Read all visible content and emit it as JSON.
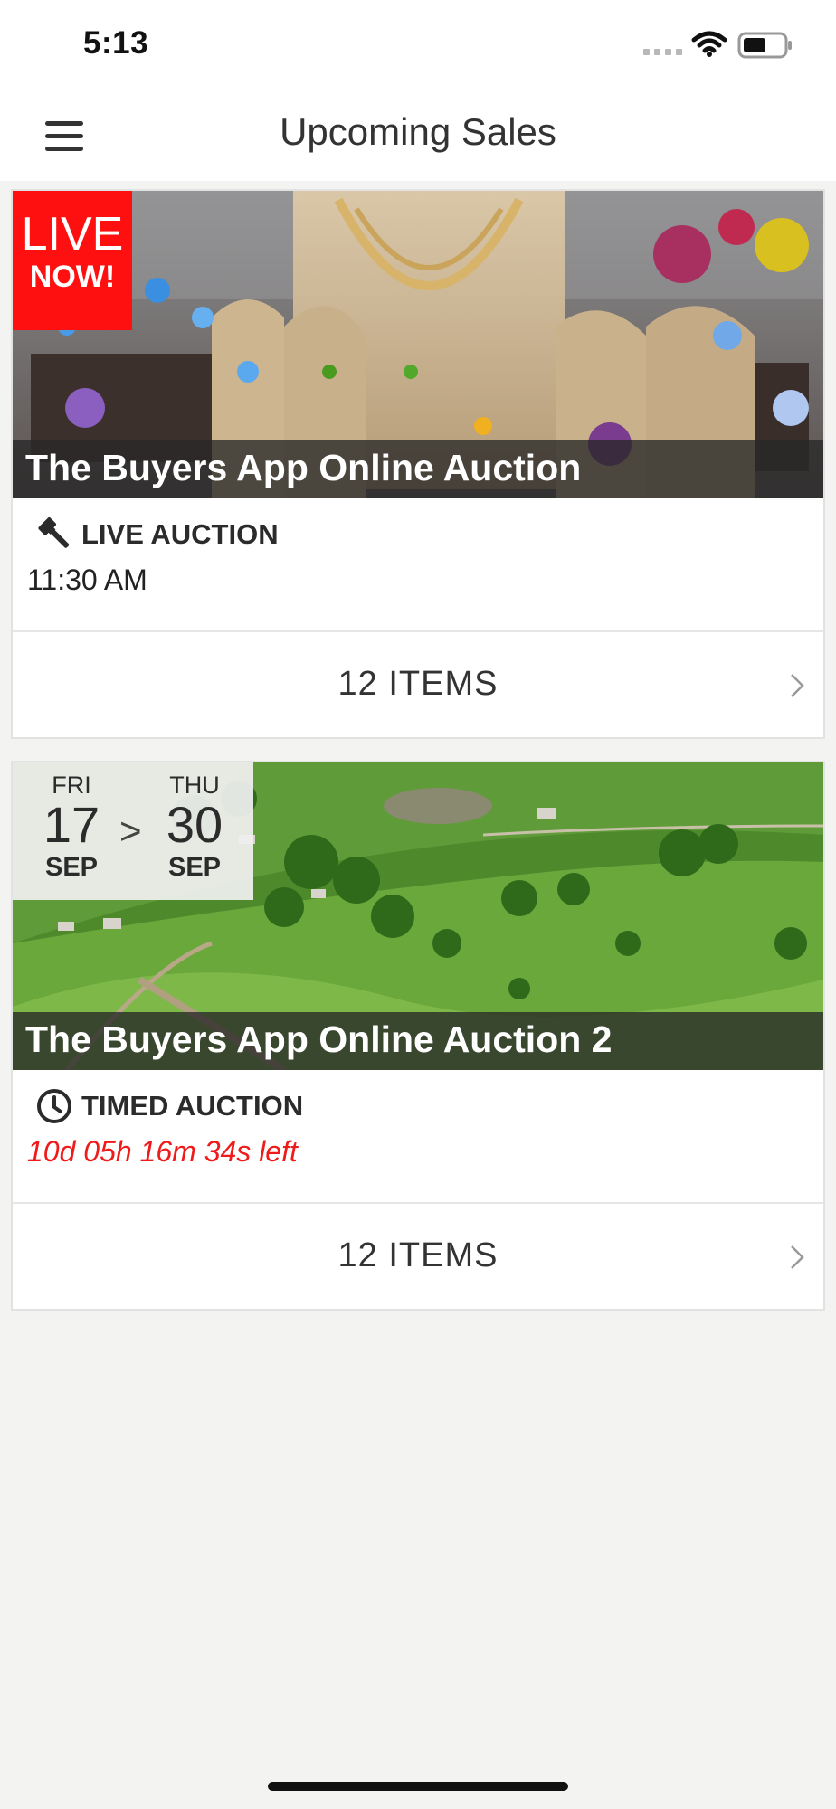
{
  "status_bar": {
    "time": "5:13",
    "icons": [
      "signal-icon",
      "wifi-icon",
      "battery-icon"
    ]
  },
  "header": {
    "title": "Upcoming Sales",
    "menu_icon": "menu-icon"
  },
  "sales": [
    {
      "badge": {
        "line1": "LIVE",
        "line2": "NOW!"
      },
      "badge_color": "#ff1010",
      "title": "The Buyers App Online Auction",
      "type_icon": "gavel-icon",
      "type_label": "LIVE AUCTION",
      "time": "11:30 AM",
      "items": "12 ITEMS"
    },
    {
      "date_range": {
        "start": {
          "dow": "FRI",
          "day": "17",
          "month": "SEP"
        },
        "separator": ">",
        "end": {
          "dow": "THU",
          "day": "30",
          "month": "SEP"
        }
      },
      "title": "The Buyers App Online Auction 2",
      "type_icon": "clock-icon",
      "type_label": "TIMED AUCTION",
      "countdown": "10d 05h 16m 34s left",
      "countdown_color": "#ef1a1a",
      "items": "12 ITEMS"
    }
  ]
}
